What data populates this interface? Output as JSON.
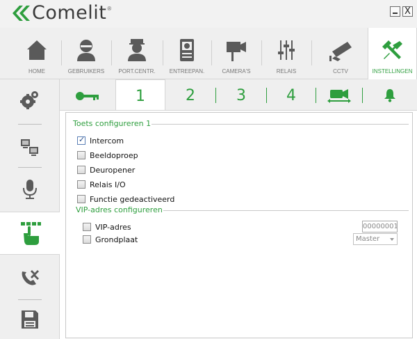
{
  "app": {
    "logo_text": "Comelit",
    "logo_mark": "®"
  },
  "window": {
    "minimize_label": "_",
    "close_label": "X"
  },
  "topnav": {
    "items": [
      {
        "label": "HOME",
        "icon": "home-icon"
      },
      {
        "label": "GEBRUIKERS",
        "icon": "user-icon"
      },
      {
        "label": "PORT.CENTR.",
        "icon": "porter-icon"
      },
      {
        "label": "ENTREEPAN.",
        "icon": "entrance-panel-icon"
      },
      {
        "label": "CAMERA'S",
        "icon": "camera-icon"
      },
      {
        "label": "RELAIS",
        "icon": "relay-icon"
      },
      {
        "label": "CCTV",
        "icon": "cctv-icon"
      },
      {
        "label": "INSTELLINGEN",
        "icon": "settings-tools-icon"
      }
    ],
    "active": "INSTELLINGEN"
  },
  "subtabs": {
    "items": [
      "1",
      "2",
      "3",
      "4"
    ],
    "active": "1"
  },
  "content": {
    "group1_title": "Toets configureren 1",
    "options": [
      {
        "label": "Intercom",
        "checked": true
      },
      {
        "label": "Beeldoproep",
        "checked": false
      },
      {
        "label": "Deuropener",
        "checked": false
      },
      {
        "label": "Relais I/O",
        "checked": false
      },
      {
        "label": "Functie gedeactiveerd",
        "checked": false
      }
    ],
    "group2_title": "VIP-adres configureren",
    "vip_label": "VIP-adres",
    "vip_value": "00000001",
    "grondplaat_label": "Grondplaat",
    "grondplaat_select": "Master"
  },
  "colors": {
    "accent": "#2e9e3e",
    "icon_gray": "#5a5a5a"
  }
}
